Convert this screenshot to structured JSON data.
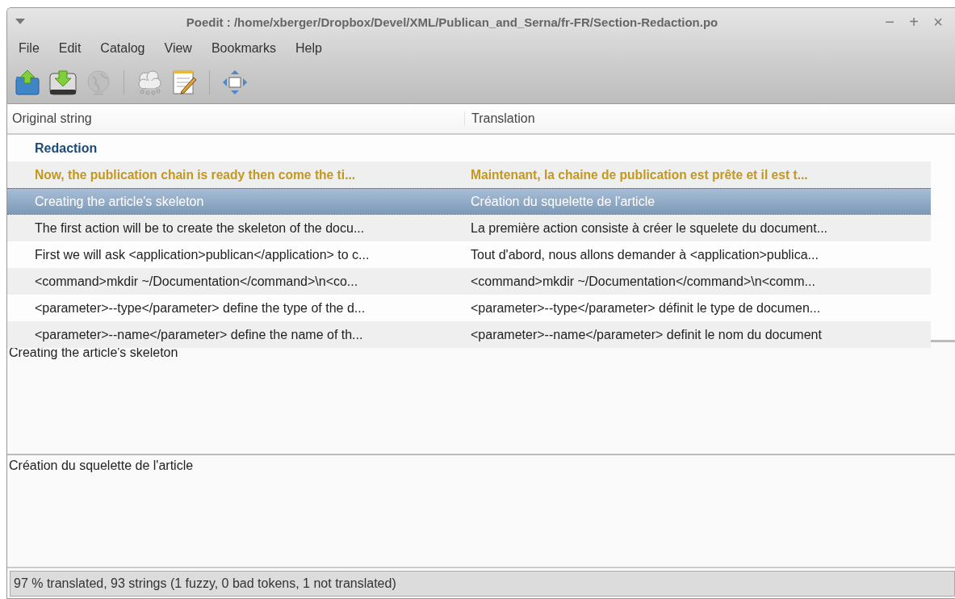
{
  "window": {
    "title": "Poedit : /home/xberger/Dropbox/Devel/XML/Publican_and_Serna/fr-FR/Section-Redaction.po",
    "controls": [
      "−",
      "+",
      "×"
    ]
  },
  "menu": [
    "File",
    "Edit",
    "Catalog",
    "View",
    "Bookmarks",
    "Help"
  ],
  "toolbar": [
    {
      "kind": "open",
      "disabled": false
    },
    {
      "kind": "save",
      "disabled": false
    },
    {
      "kind": "globe",
      "disabled": true
    },
    {
      "kind": "sep"
    },
    {
      "kind": "clouds",
      "disabled": false
    },
    {
      "kind": "notepad",
      "disabled": false
    },
    {
      "kind": "sep"
    },
    {
      "kind": "fit",
      "disabled": false
    }
  ],
  "table": {
    "columns": [
      "Original string",
      "Translation"
    ],
    "rows": [
      {
        "kind": "section",
        "original": "Redaction",
        "selected": false
      },
      {
        "kind": "fuzzy",
        "original": "Now, the publication chain is ready then come the ti...",
        "translation": "Maintenant, la chaine de publication est prête et il est t...",
        "selected": false
      },
      {
        "kind": "normal",
        "original": "Creating the article's skeleton",
        "translation": "Création du squelette de l'article",
        "selected": true
      },
      {
        "kind": "normal",
        "original": "The first action will be to create the skeleton of the docu...",
        "translation": "La première action consiste à créer le squelete du document...",
        "selected": false
      },
      {
        "kind": "normal",
        "original": "First we will ask <application>publican</application> to c...",
        "translation": "Tout d'abord, nous allons demander à <application>publica...",
        "selected": false
      },
      {
        "kind": "normal",
        "original": "<command>mkdir ~/Documentation</command>\\n<co...",
        "translation": "<command>mkdir ~/Documentation</command>\\n<comm...",
        "selected": false
      },
      {
        "kind": "normal",
        "original": "<parameter>--type</parameter> define the type of the d...",
        "translation": "<parameter>--type</parameter> définit le type de documen...",
        "selected": false
      },
      {
        "kind": "normal",
        "original": "<parameter>--name</parameter> define the name of th...",
        "translation": "<parameter>--name</parameter> definit le nom du document",
        "selected": false
      }
    ]
  },
  "source_text": "Creating the article's skeleton",
  "translation_text": "Création du squelette de l'article",
  "status_bar": "97 % translated, 93 strings (1 fuzzy, 0 bad tokens, 1 not translated)"
}
